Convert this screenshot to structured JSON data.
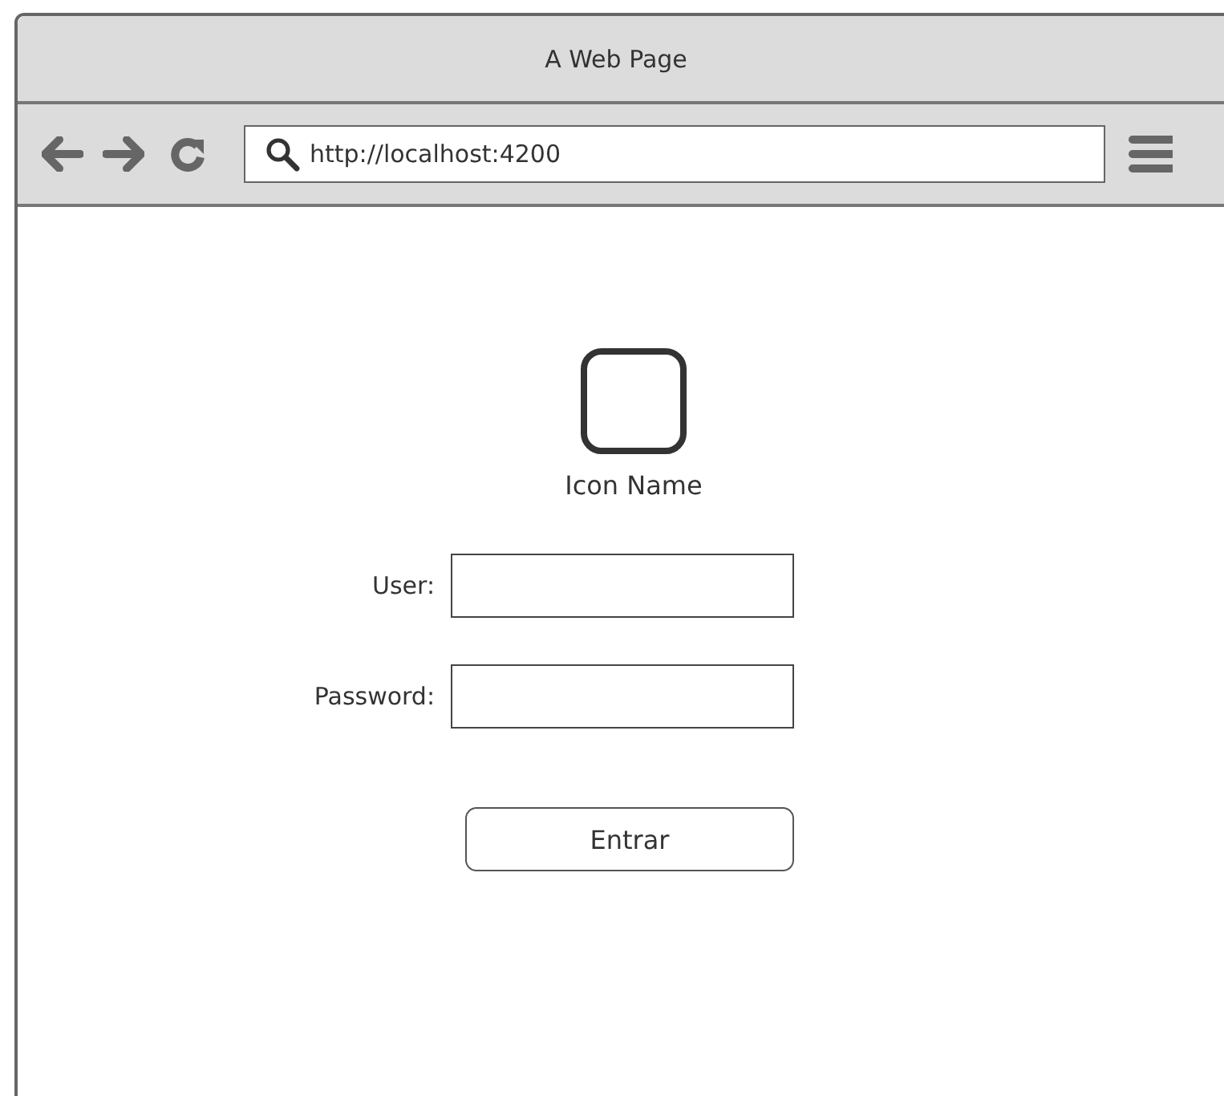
{
  "window": {
    "title": "A Web Page"
  },
  "toolbar": {
    "url": "http://localhost:4200"
  },
  "content": {
    "icon_label": "Icon Name",
    "fields": [
      {
        "label": "User:"
      },
      {
        "label": "Password:"
      }
    ],
    "button": "Entrar"
  }
}
